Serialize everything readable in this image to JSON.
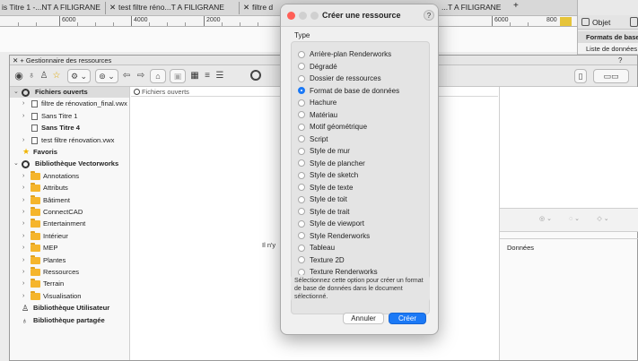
{
  "doc_tabs": {
    "tab1": "is Titre 1 -...NT A FILIGRANE",
    "tab2": "test filtre réno...T A FILIGRANE",
    "tab3": "filtre d",
    "tab4": "...T A FILIGRANE",
    "close_glyph": "✕",
    "new_tab": "+"
  },
  "ruler": {
    "n1": "6000",
    "n2": "4000",
    "n3": "2000",
    "n4": "6000",
    "n5": "800"
  },
  "obj_palette": {
    "tab_object": "Objet",
    "line1": "Formats de base",
    "line2": "Liste de données"
  },
  "resource_manager": {
    "title": "Gestionnaire des ressources",
    "title_icons": "✕ +",
    "help": "?",
    "tree": [
      {
        "label": "Fichiers ouverts",
        "bold": true
      },
      {
        "label": "filtre de rénovation_final.vwx"
      },
      {
        "label": "Sans Titre 1"
      },
      {
        "label": "Sans Titre 4",
        "bold": true
      },
      {
        "label": "test filtre rénovation.vwx"
      },
      {
        "label": "Favoris",
        "bold": true
      },
      {
        "label": "Bibliothèque Vectorworks",
        "bold": true
      },
      {
        "label": "Annotations"
      },
      {
        "label": "Attributs"
      },
      {
        "label": "Bâtiment"
      },
      {
        "label": "ConnectCAD"
      },
      {
        "label": "Entertainment"
      },
      {
        "label": "Intérieur"
      },
      {
        "label": "MEP"
      },
      {
        "label": "Plantes"
      },
      {
        "label": "Ressources"
      },
      {
        "label": "Terrain"
      },
      {
        "label": "Visualisation"
      },
      {
        "label": "Bibliothèque Utilisateur",
        "bold": true
      },
      {
        "label": "Bibliothèque partagée",
        "bold": true
      }
    ],
    "preview_header": "Fichiers ouverts",
    "preview_empty": "Il n'y",
    "right_donnees": "Données"
  },
  "dialog": {
    "title": "Créer une ressource",
    "help": "?",
    "type_label": "Type",
    "options": [
      "Arrière-plan Renderworks",
      "Dégradé",
      "Dossier de ressources",
      "Format de base de données",
      "Hachure",
      "Matériau",
      "Motif géométrique",
      "Script",
      "Style de mur",
      "Style de plancher",
      "Style de sketch",
      "Style de texte",
      "Style de toit",
      "Style de trait",
      "Style de viewport",
      "Style Renderworks",
      "Tableau",
      "Texture 2D",
      "Texture Renderworks"
    ],
    "selected_index": 3,
    "description": "Sélectionnez cette option pour créer un format de base de données dans le document sélectionné.",
    "cancel": "Annuler",
    "ok": "Créer"
  },
  "colors": {
    "accent": "#1b79f6",
    "folder": "#f5b52c"
  }
}
